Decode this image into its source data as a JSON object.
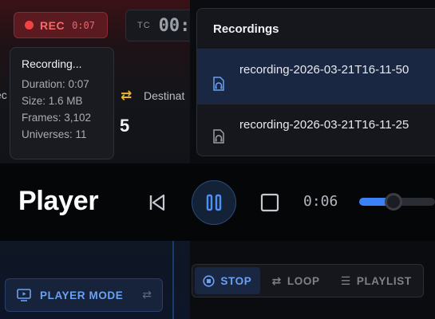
{
  "recorder": {
    "rec_label": "REC",
    "rec_time": "0:07",
    "tc_label": "TC",
    "tc_value": "00:"
  },
  "stats": {
    "left_label_clip": "ec",
    "destination_label": "Destinat",
    "destination_value": "5"
  },
  "tooltip": {
    "title": "Recording...",
    "lines": [
      "Duration: 0:07",
      "Size: 1.6 MB",
      "Frames: 3,102",
      "Universes: 11"
    ]
  },
  "player_mode_button": {
    "label": "PLAYER MODE"
  },
  "recordings": {
    "header": "Recordings",
    "items": [
      {
        "name": "recording-2026-03-21T16-11-50",
        "selected": true
      },
      {
        "name": "recording-2026-03-21T16-11-25",
        "selected": false
      }
    ]
  },
  "player": {
    "title": "Player",
    "time": "0:06",
    "progress_fraction": 0.45
  },
  "play_modes": {
    "stop": "STOP",
    "loop": "LOOP",
    "playlist": "PLAYLIST",
    "active": "stop"
  },
  "colors": {
    "accent": "#3b82f6",
    "recording_red": "#ef4444",
    "destination_icon": "#f0b429"
  }
}
